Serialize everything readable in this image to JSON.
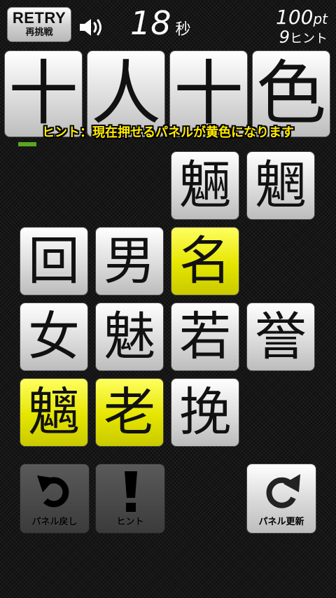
{
  "header": {
    "retry_label": "RETRY",
    "retry_sublabel": "再挑戦",
    "speaker_icon": "speaker-icon",
    "timer_value": "18",
    "timer_unit": "秒",
    "score_value": "100",
    "score_unit": "pt",
    "hints_value": "9",
    "hints_unit": "ヒント"
  },
  "answer": [
    "十",
    "人",
    "十",
    "色"
  ],
  "hint_message": "ヒント：現在押せるパネルが黄色になります",
  "progress_fraction": 0.2,
  "colors": {
    "highlight": "#e5e500",
    "hint_text": "#ffea00",
    "progress": "#5aa81f"
  },
  "grid": [
    {
      "char": "魎",
      "highlighted": false
    },
    {
      "char": "魍",
      "highlighted": false
    },
    {
      "char": "回",
      "highlighted": false
    },
    {
      "char": "男",
      "highlighted": false
    },
    {
      "char": "名",
      "highlighted": true
    },
    {
      "char": "女",
      "highlighted": false
    },
    {
      "char": "魅",
      "highlighted": false
    },
    {
      "char": "若",
      "highlighted": false
    },
    {
      "char": "誉",
      "highlighted": false
    },
    {
      "char": "魑",
      "highlighted": true
    },
    {
      "char": "老",
      "highlighted": true
    },
    {
      "char": "挽",
      "highlighted": false
    }
  ],
  "controls": {
    "undo_label": "パネル戻し",
    "undo_icon": "undo-arrow-icon",
    "hint_label": "ヒント",
    "hint_icon": "exclamation-icon",
    "refresh_label": "パネル更新",
    "refresh_icon": "refresh-arrow-icon"
  }
}
